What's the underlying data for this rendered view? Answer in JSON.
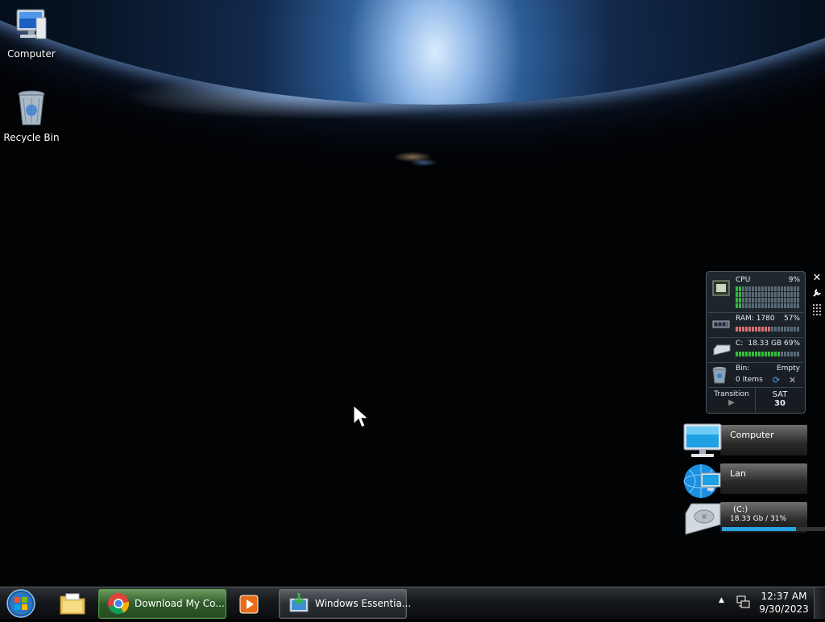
{
  "desktop": {
    "icons": [
      {
        "label": "Computer",
        "icon": "computer-icon"
      },
      {
        "label": "Recycle Bin",
        "icon": "recycle-bin-icon"
      }
    ]
  },
  "gadget": {
    "cpu_label": "CPU",
    "cpu_value": "9%",
    "ram_label": "RAM: 1780",
    "ram_value": "57%",
    "drive_label": "C:",
    "drive_value": "18.33 GB 69%",
    "bin_label": "Bin:",
    "bin_state": "Empty",
    "bin_items": "0 Items",
    "transition_label": "Transition",
    "day": "SAT",
    "date": "30",
    "controls": [
      "close-icon",
      "wrench-icon",
      "grip-icon"
    ]
  },
  "tiles": {
    "computer": "Computer",
    "lan": "Lan",
    "drive_name": "(C:)",
    "drive_info": "18.33 Gb / 31%",
    "drive_used_fraction": 0.69
  },
  "taskbar": {
    "start": "start-orb-icon",
    "pinned": [
      {
        "icon": "file-explorer-icon"
      },
      {
        "icon": "media-player-icon"
      }
    ],
    "tasks": [
      {
        "label": "Download My Co...",
        "icon": "chrome-icon"
      },
      {
        "label": "Windows Essentia...",
        "icon": "installer-icon"
      }
    ],
    "tray": {
      "show_hidden": "▲",
      "time": "12:37 AM",
      "date": "9/30/2023"
    }
  },
  "colors": {
    "accent": "#29a3e0",
    "bar_green": "#2fbf3a",
    "bar_red": "#d87070"
  }
}
